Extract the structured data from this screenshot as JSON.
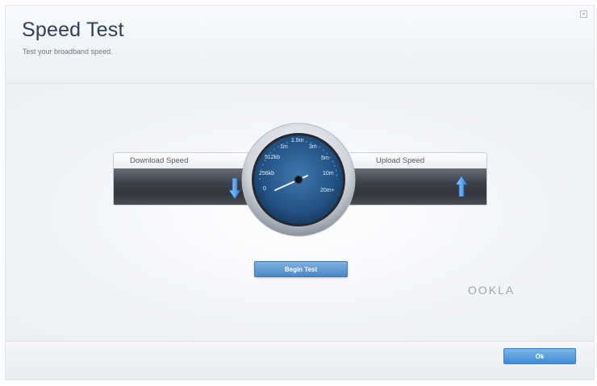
{
  "dialog": {
    "title": "Speed Test",
    "subtitle": "Test your broadband speed.",
    "close_icon": "close-icon"
  },
  "speedtest": {
    "download_label": "Download Speed",
    "upload_label": "Upload Speed",
    "download_icon": "arrow-down-icon",
    "upload_icon": "arrow-up-icon",
    "gauge_labels": [
      "0",
      "256kb",
      "512kb",
      "1m",
      "1.5m",
      "3m",
      "5m",
      "10m",
      "20m+"
    ],
    "gauge_value": "0",
    "begin_label": "Begin Test",
    "provider_logo": "OOKLA"
  },
  "footer": {
    "ok_label": "Ok"
  },
  "colors": {
    "title": "#2f3f59",
    "button_blue": "#4a86c6",
    "gauge_face": "#1f4f7f"
  }
}
